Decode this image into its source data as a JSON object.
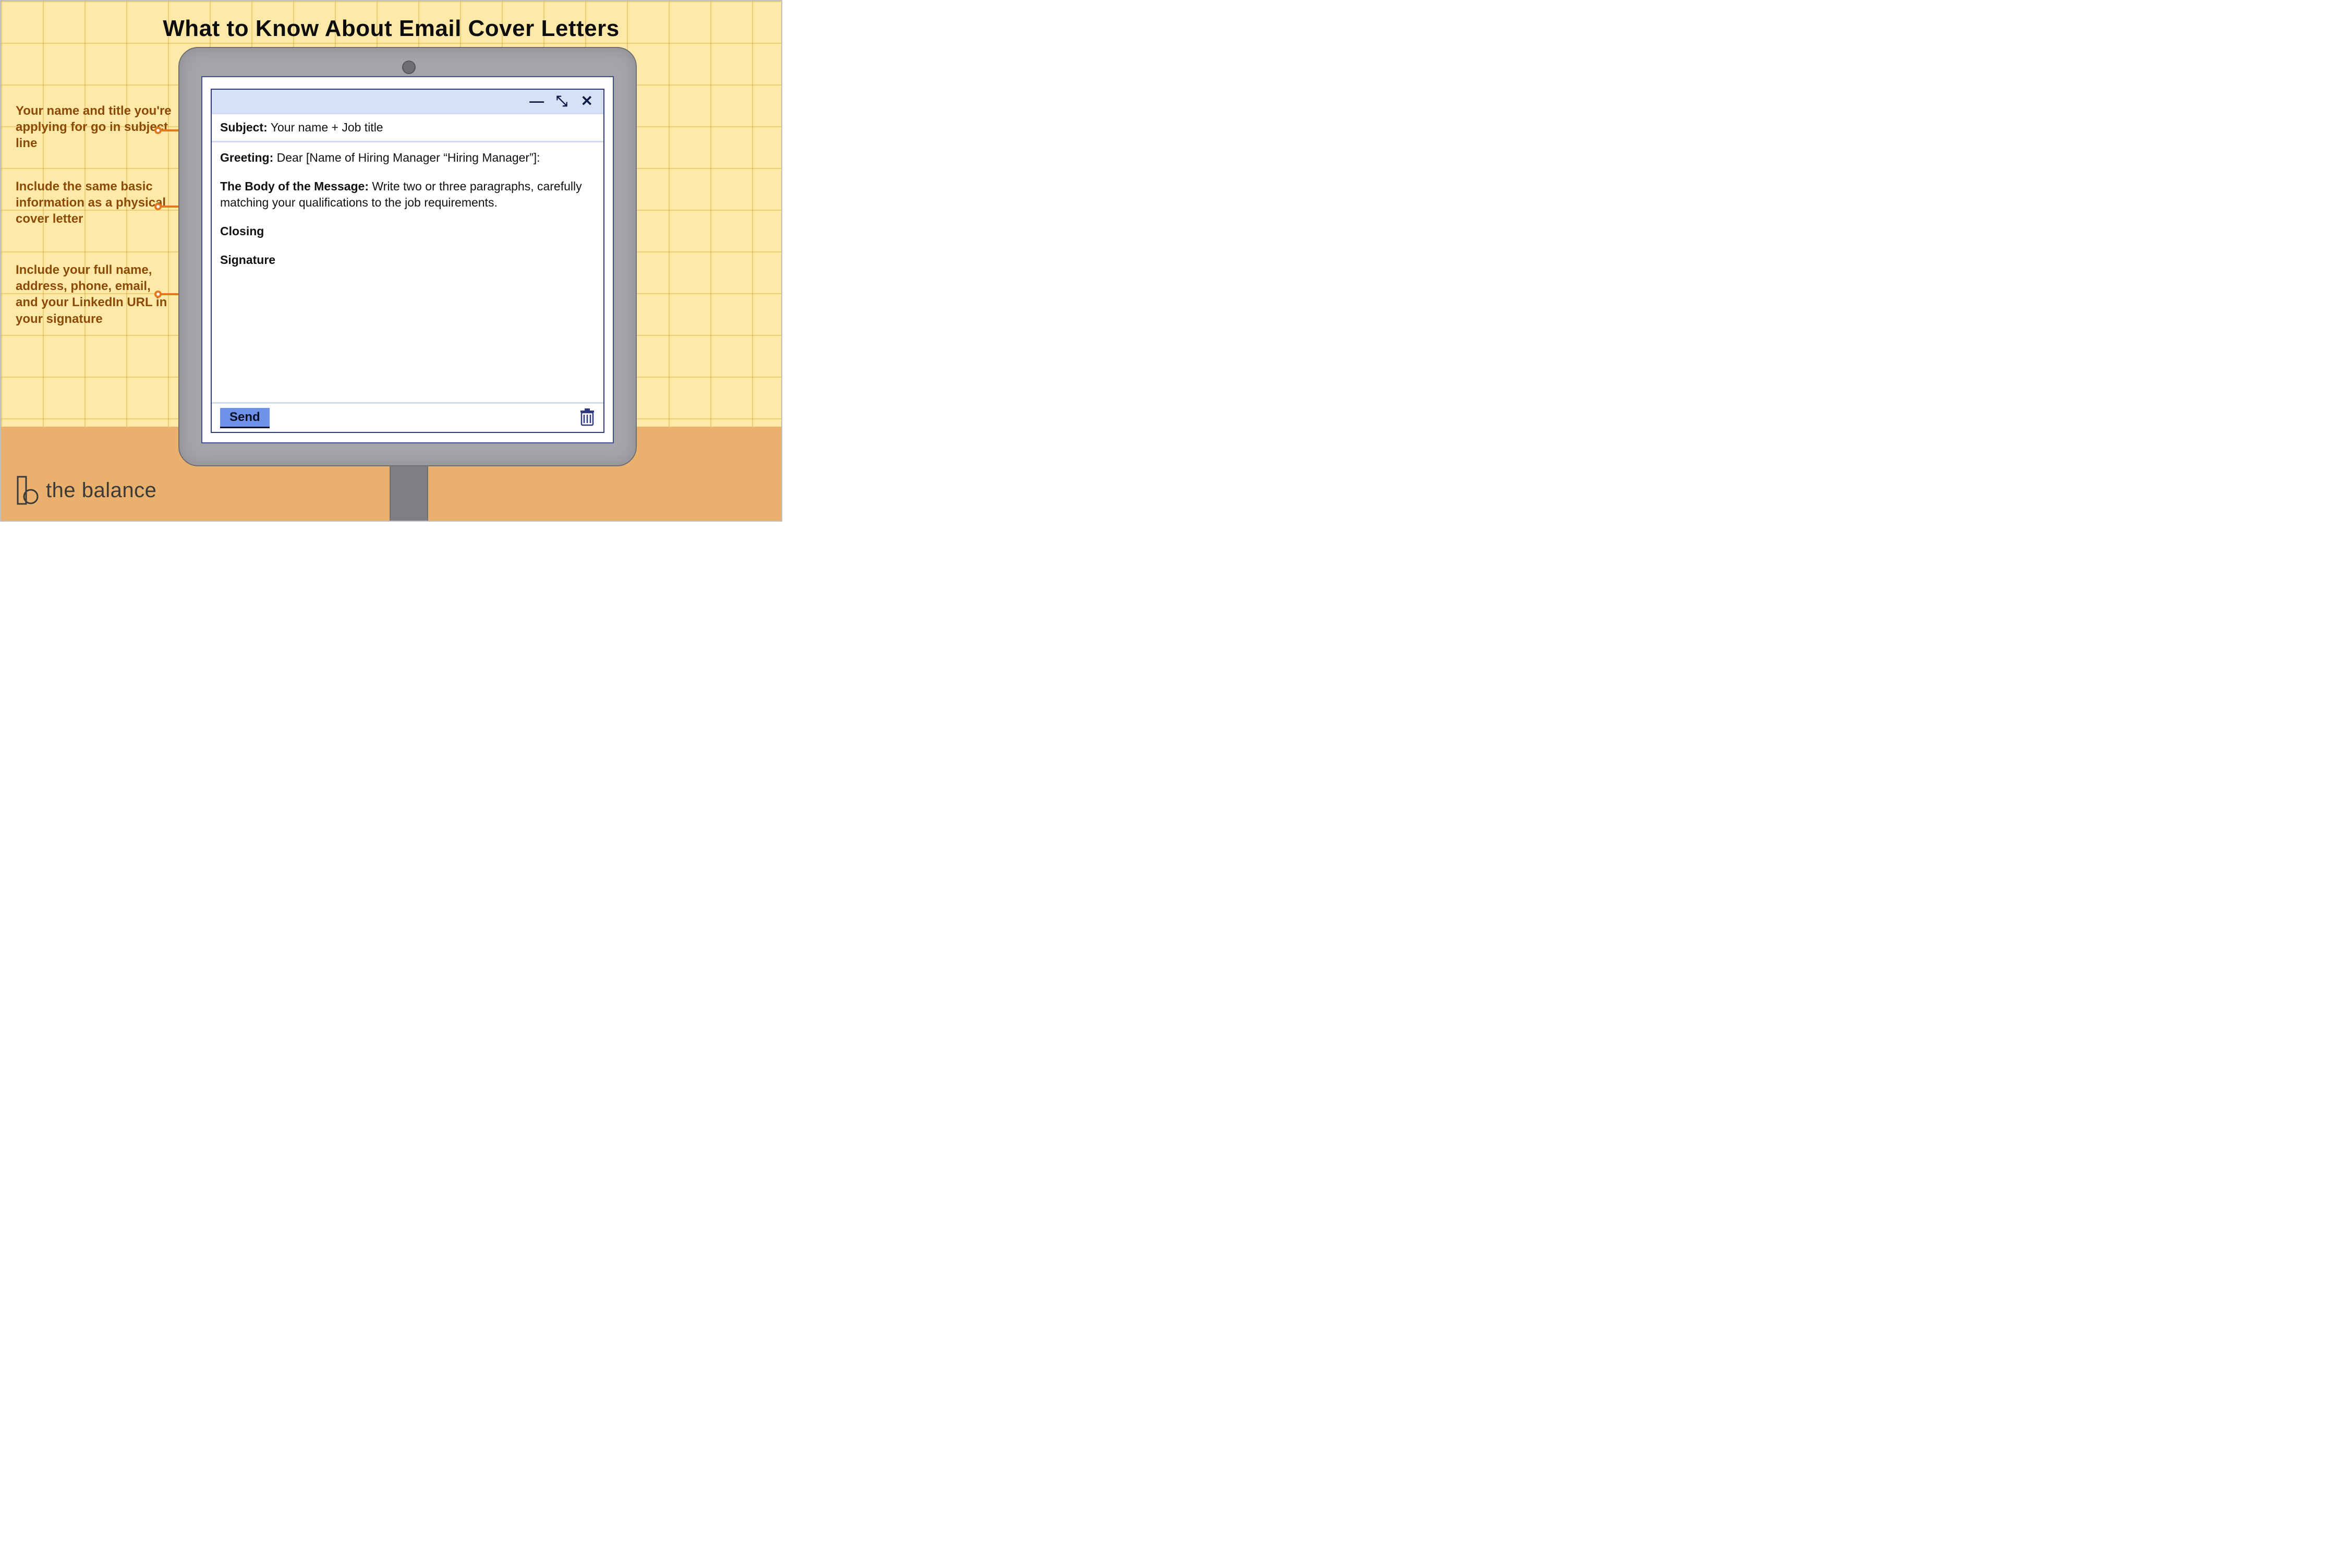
{
  "title": "What to Know About Email Cover Letters",
  "annotations": {
    "a1": "Your name and title you're applying for go in subject line",
    "a2": "Include the same basic information as a physical cover letter",
    "a3": "Include your full name, address, phone, email, and your LinkedIn URL in your signature"
  },
  "email": {
    "subject_label": "Subject:",
    "subject_value": "Your name + Job title",
    "greeting_label": "Greeting:",
    "greeting_value": "Dear [Name of Hiring Manager “Hiring Manager”]:",
    "body_label": "The Body of the Message:",
    "body_value": "Write two or three paragraphs, carefully matching your qualifications to the job requirements.",
    "closing_label": "Closing",
    "signature_label": "Signature",
    "send_label": "Send"
  },
  "brand": "the balance"
}
